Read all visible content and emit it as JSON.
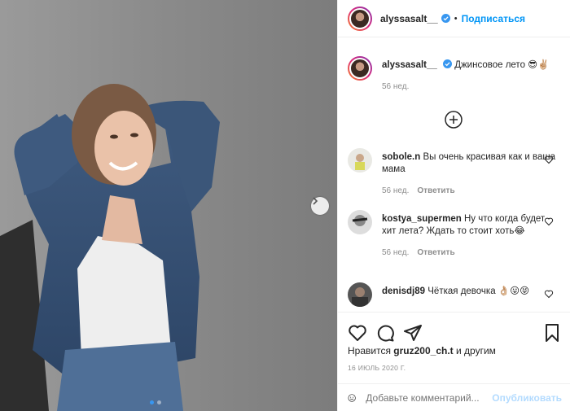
{
  "post": {
    "username": "alyssasalt__",
    "follow_label": "Подписаться",
    "separator": "•",
    "caption_text": "Джинсовое лето 😎✌🏼",
    "caption_time": "56 нед."
  },
  "comments": [
    {
      "username": "sobole.n",
      "text": "Вы очень красивая как и ваша мама",
      "time": "56 нед.",
      "reply": "Ответить"
    },
    {
      "username": "kostya_supermen",
      "text": "Ну что когда будет хит лета? Ждать то стоит хоть😂",
      "time": "56 нед.",
      "reply": "Ответить"
    },
    {
      "username": "denisdj89",
      "text": "Чёткая девочка 👌🏼😛😝",
      "time": "",
      "reply": ""
    }
  ],
  "likes": {
    "prefix": "Нравится",
    "user": "gruz200_ch.t",
    "suffix": "и другим"
  },
  "date": "16 ИЮЛЬ 2020 Г.",
  "add_comment": {
    "placeholder": "Добавьте комментарий...",
    "publish": "Опубликовать"
  },
  "colors": {
    "accent": "#0095f6",
    "muted": "#8e8e8e",
    "border": "#efefef"
  },
  "icons": [
    "verified-icon",
    "next-arrow-icon",
    "plus-circle-icon",
    "heart-icon",
    "comment-icon",
    "share-icon",
    "bookmark-icon",
    "smile-icon"
  ]
}
